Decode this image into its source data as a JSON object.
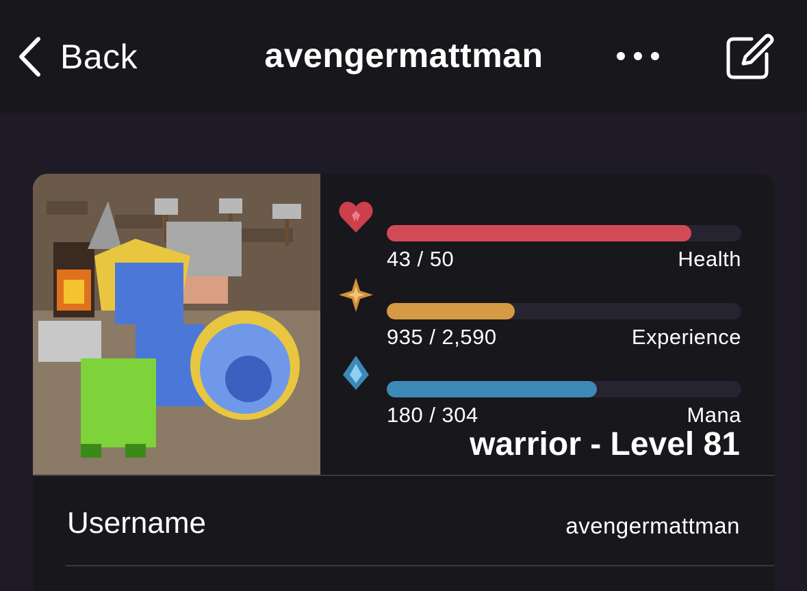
{
  "nav": {
    "back_label": "Back",
    "title": "avengermattman",
    "more_icon": "more-horizontal-icon",
    "edit_icon": "edit-icon"
  },
  "stats": [
    {
      "icon": "heart-icon",
      "value": "43 / 50",
      "label": "Health",
      "fraction": 0.86,
      "color": "#d14a55"
    },
    {
      "icon": "star-icon",
      "value": "935 / 2,590",
      "label": "Experience",
      "fraction": 0.361,
      "color": "#d59a44"
    },
    {
      "icon": "mana-drop-icon",
      "value": "180 / 304",
      "label": "Mana",
      "fraction": 0.592,
      "color": "#3e89b8"
    }
  ],
  "class_level": "warrior - Level 81",
  "details": [
    {
      "label": "Username",
      "value": "avengermattman"
    }
  ],
  "colors": {
    "background": "#1e1b27",
    "navbar": "#18171b",
    "card": "#18171b"
  }
}
